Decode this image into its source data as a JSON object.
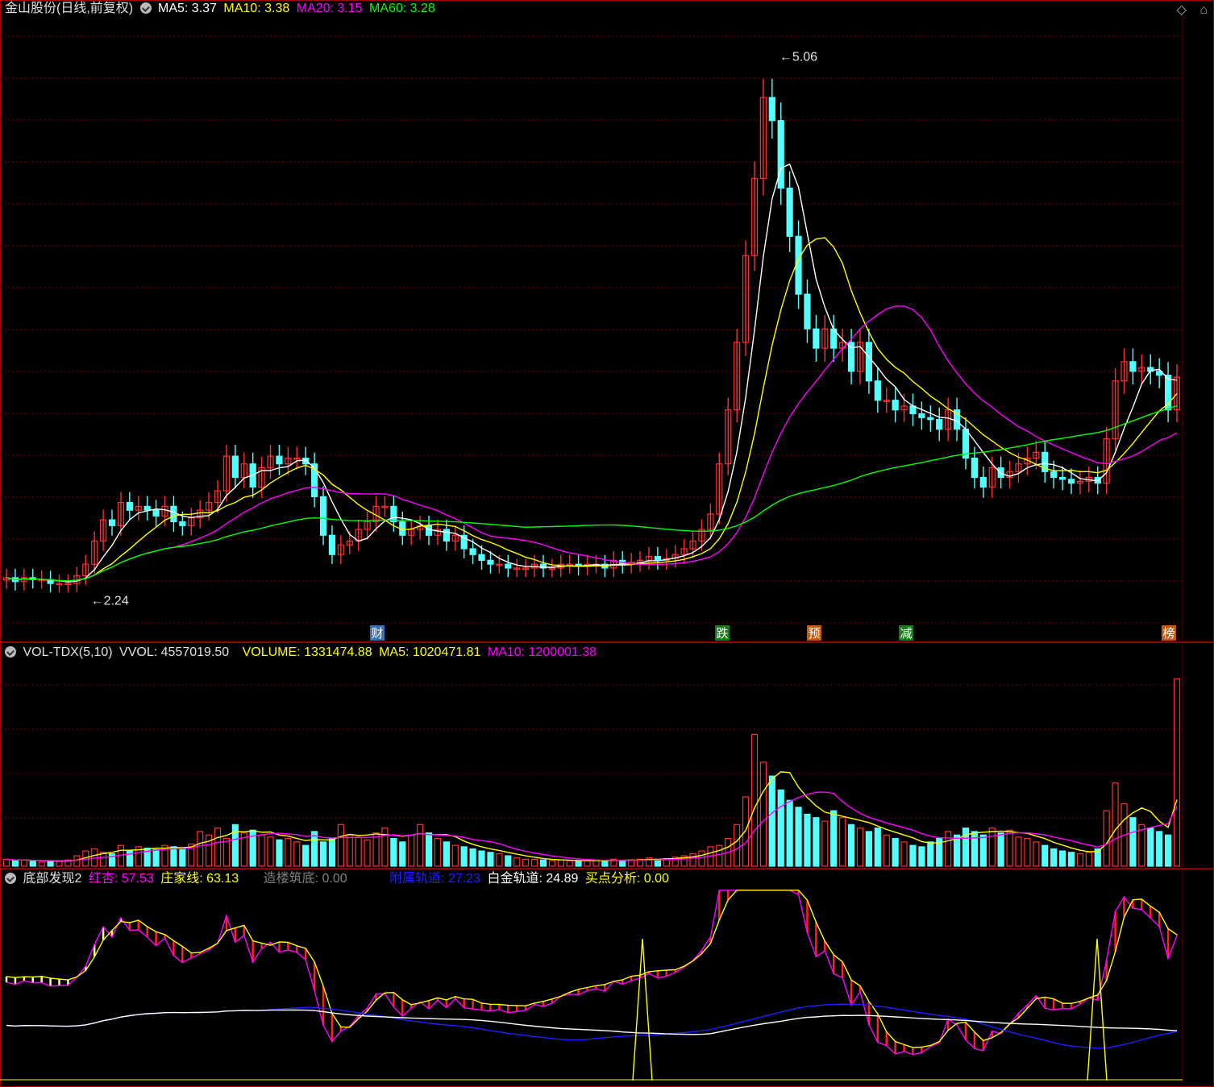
{
  "main": {
    "title": "金山股份(日线,前复权)",
    "ma": [
      {
        "label": "MA5: 3.37",
        "color": "#ffffff"
      },
      {
        "label": "MA10: 3.38",
        "color": "#ffff00"
      },
      {
        "label": "MA20: 3.15",
        "color": "#ff00ff"
      },
      {
        "label": "MA60: 3.28",
        "color": "#00ff00"
      }
    ],
    "high_label": "5.06",
    "low_label": "2.24",
    "events": [
      {
        "text": "财",
        "color": "#3a6fb0"
      },
      {
        "text": "跌",
        "color": "#1d7a1d"
      },
      {
        "text": "预",
        "color": "#c55a11"
      },
      {
        "text": "减",
        "color": "#1d7a1d"
      },
      {
        "text": "榜",
        "color": "#c55a11"
      }
    ]
  },
  "volume": {
    "name": "VOL-TDX(5,10)",
    "vvol": "VVOL: 4557019.50",
    "volume": "VOLUME: 1331474.88",
    "ma5": "MA5: 1020471.81",
    "ma10": "MA10: 1200001.38"
  },
  "indicator": {
    "name": "底部发现2",
    "hongxing": "红杏: 57.53",
    "zhuangjia": "庄家线: 63.13",
    "zaolou": "造楼筑底: 0.00",
    "fushu": "附属轨道: 27.23",
    "baijin": "白金轨道: 24.89",
    "maidian": "买点分析: 0.00"
  },
  "toolbar": {
    "diamond_icon": "◇",
    "pin_icon": "⌂"
  },
  "chart_data": [
    {
      "type": "candlestick",
      "title": "金山股份(日线,前复权)",
      "ylim": [
        2.1,
        5.2
      ],
      "high": 5.06,
      "low": 2.24,
      "close": [
        2.33,
        2.31,
        2.33,
        2.32,
        2.32,
        2.3,
        2.3,
        2.3,
        2.34,
        2.4,
        2.52,
        2.63,
        2.6,
        2.72,
        2.68,
        2.7,
        2.68,
        2.65,
        2.7,
        2.62,
        2.6,
        2.64,
        2.68,
        2.72,
        2.78,
        2.96,
        2.85,
        2.92,
        2.8,
        2.9,
        2.96,
        2.92,
        2.95,
        2.95,
        2.92,
        2.75,
        2.55,
        2.45,
        2.5,
        2.52,
        2.58,
        2.62,
        2.7,
        2.7,
        2.62,
        2.55,
        2.58,
        2.6,
        2.55,
        2.58,
        2.52,
        2.55,
        2.48,
        2.45,
        2.42,
        2.4,
        2.4,
        2.38,
        2.38,
        2.38,
        2.4,
        2.38,
        2.38,
        2.4,
        2.4,
        2.39,
        2.4,
        2.4,
        2.38,
        2.42,
        2.4,
        2.41,
        2.42,
        2.44,
        2.42,
        2.43,
        2.45,
        2.48,
        2.52,
        2.58,
        2.66,
        2.92,
        3.2,
        3.55,
        4.0,
        4.4,
        4.82,
        4.7,
        4.35,
        4.1,
        3.8,
        3.62,
        3.52,
        3.62,
        3.52,
        3.55,
        3.4,
        3.55,
        3.35,
        3.25,
        3.25,
        3.2,
        3.22,
        3.18,
        3.16,
        3.15,
        3.1,
        3.2,
        3.1,
        2.95,
        2.85,
        2.8,
        2.9,
        2.85,
        2.88,
        2.92,
        2.95,
        2.98,
        2.88,
        2.85,
        2.84,
        2.82,
        2.83,
        2.85,
        2.82,
        3.05,
        3.35,
        3.45,
        3.4,
        3.42,
        3.4,
        3.38,
        3.2,
        3.37
      ]
    },
    {
      "type": "bar",
      "title": "VOL-TDX(5,10)",
      "series": [
        {
          "name": "VOLUME",
          "values": [
            10,
            8,
            9,
            7,
            6,
            8,
            7,
            9,
            15,
            22,
            25,
            20,
            18,
            30,
            22,
            28,
            26,
            24,
            30,
            28,
            25,
            32,
            50,
            45,
            55,
            40,
            60,
            48,
            52,
            45,
            42,
            38,
            40,
            35,
            30,
            50,
            35,
            40,
            60,
            45,
            42,
            38,
            48,
            55,
            40,
            35,
            45,
            60,
            48,
            40,
            35,
            30,
            28,
            25,
            22,
            20,
            18,
            15,
            12,
            10,
            10,
            9,
            8,
            9,
            8,
            7,
            8,
            9,
            8,
            10,
            8,
            9,
            10,
            12,
            10,
            11,
            13,
            15,
            18,
            22,
            28,
            30,
            40,
            60,
            100,
            190,
            150,
            130,
            110,
            95,
            85,
            75,
            70,
            65,
            80,
            70,
            60,
            55,
            50,
            55,
            45,
            40,
            35,
            30,
            28,
            35,
            40,
            50,
            45,
            55,
            50,
            45,
            55,
            48,
            52,
            42,
            40,
            35,
            30,
            25,
            22,
            20,
            18,
            20,
            25,
            80,
            120,
            90,
            70,
            60,
            55,
            50,
            45,
            270
          ]
        }
      ]
    },
    {
      "type": "line",
      "title": "底部发现2",
      "series": [
        {
          "name": "红杏",
          "last": 57.53
        },
        {
          "name": "庄家线",
          "last": 63.13
        },
        {
          "name": "造楼筑底",
          "last": 0.0
        },
        {
          "name": "附属轨道",
          "last": 27.23
        },
        {
          "name": "白金轨道",
          "last": 24.89
        },
        {
          "name": "买点分析",
          "last": 0.0
        }
      ]
    }
  ]
}
